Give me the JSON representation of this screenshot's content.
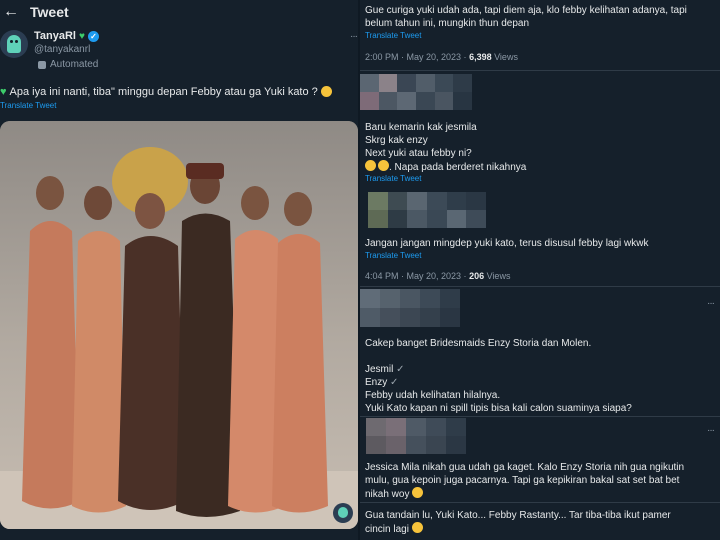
{
  "header": {
    "back_icon": "arrow-left-icon",
    "title": "Tweet"
  },
  "main_tweet": {
    "display_name": "TanyaRl",
    "handle": "@tanyakanrl",
    "automated_label": "Automated",
    "text_before": "Apa iya ini nanti, tiba\" minggu depan Febby atau ga Yuki kato ?",
    "translate": "Translate Tweet",
    "photo": "wedding-photo"
  },
  "right": {
    "c1": {
      "line1": "Gue curiga yuki udah ada, tapi diem aja, klo febby kelihatan adanya, tapi",
      "line2": "belum tahun ini, mungkin thun depan",
      "translate": "Translate Tweet",
      "time": "2:00 PM · May 20, 2023 · ",
      "views_count": "6,398",
      "views_label": " Views"
    },
    "c2": {
      "line1": "Baru kemarin kak jesmila",
      "line2": "Skrg kak enzy",
      "line3": "Next yuki atau febby ni?",
      "line4": ". Napa pada berderet nikahnya",
      "translate": "Translate Tweet"
    },
    "c3": {
      "line1": "Jangan jangan mingdep yuki kato, terus disusul febby lagi wkwk",
      "translate": "Translate Tweet",
      "time": "4:04 PM · May 20, 2023 · ",
      "views_count": "206",
      "views_label": " Views"
    },
    "c4": {
      "line1": "Cakep banget Bridesmaids Enzy Storia dan Molen.",
      "line2": "Jesmil",
      "line3": "Enzy",
      "line4": "Febby udah kelihatan hilalnya.",
      "line5": "Yuki Kato kapan ni spill tipis bisa kali calon suaminya siapa?"
    },
    "c5": {
      "line1": "Jessica Mila nikah gua udah ga kaget. Kalo Enzy Storia nih gua ngikutin",
      "line2": "mulu, gua kepoin juga pacarnya. Tapi ga kepikiran bakal sat set bat bet",
      "line3": "nikah woy"
    },
    "c6": {
      "line1": "Gua tandain lu, Yuki Kato... Febby Rastanty... Tar tiba-tiba ikut pamer",
      "line2": "cincin lagi"
    }
  },
  "colors": {
    "bg": "#15202b",
    "link": "#1d9bf0",
    "muted": "#8b98a5",
    "text": "#e7e9ea"
  }
}
